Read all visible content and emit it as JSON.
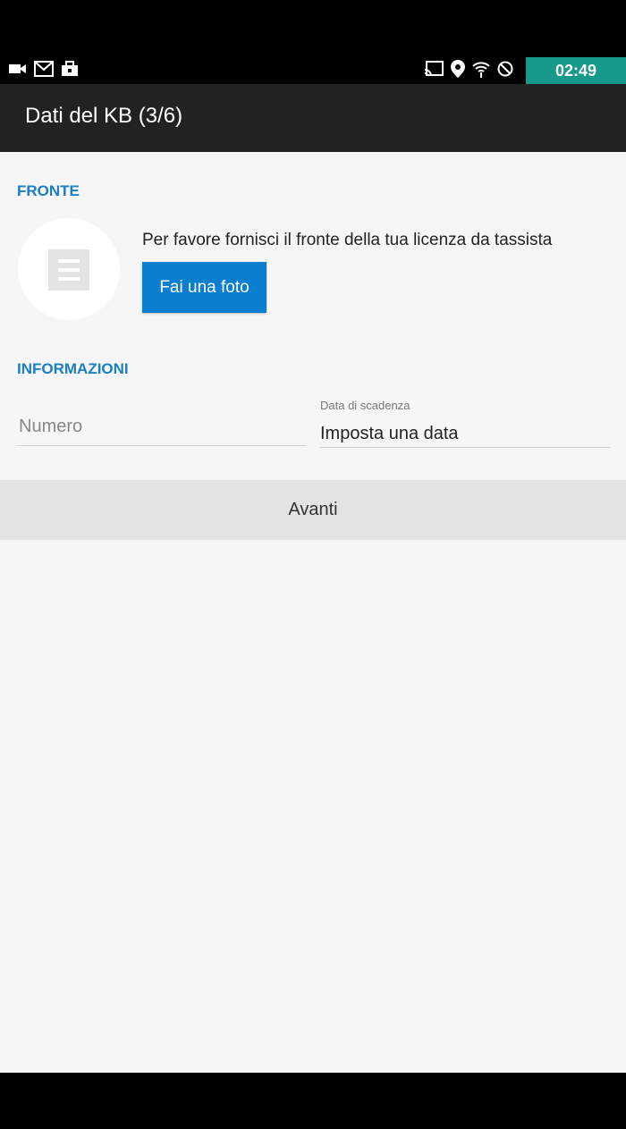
{
  "status_bar": {
    "time": "02:49",
    "left_icons": [
      "video-camera-icon",
      "gmail-icon",
      "briefcase-icon"
    ],
    "right_icons": [
      "cast-icon",
      "location-pin-icon",
      "wifi-icon",
      "do-not-disturb-icon"
    ],
    "accent": "#16988a"
  },
  "app_bar": {
    "title": "Dati del KB (3/6)"
  },
  "fronte": {
    "header": "FRONTE",
    "description": "Per favore fornisci il fronte della tua licenza da tassista",
    "photo_button": "Fai una foto",
    "thumbnail_icon": "document-icon"
  },
  "informazioni": {
    "header": "INFORMAZIONI",
    "numero_placeholder": "Numero",
    "numero_value": "",
    "date_label": "Data di scadenza",
    "date_value": "Imposta una data"
  },
  "next_button": "Avanti",
  "colors": {
    "accent_blue": "#1a7fc1",
    "button_blue": "#0b7fcf",
    "app_bar": "#222222",
    "background": "#f6f6f6"
  }
}
